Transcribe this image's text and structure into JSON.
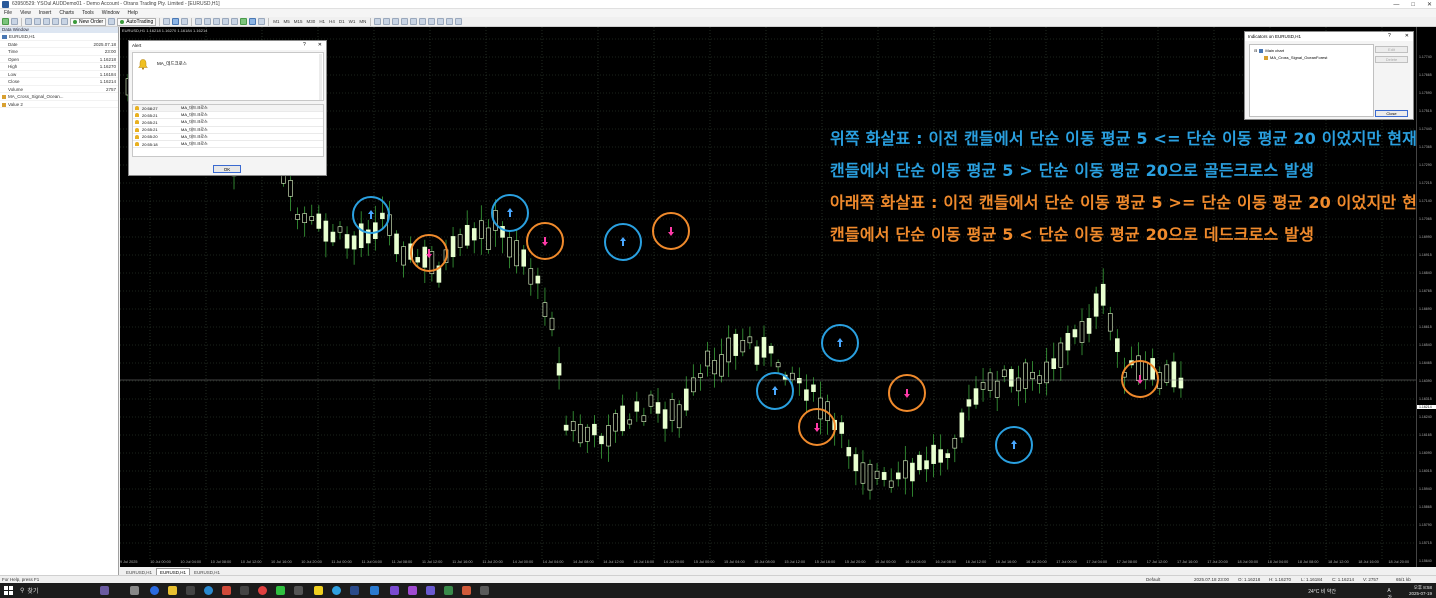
{
  "window": {
    "title": "63950529: YSOul AUDDemo01 - Demo Account - Otrans Trading Pty. Limited - [EURUSD,H1]",
    "controls": [
      "—",
      "□",
      "✕"
    ]
  },
  "menu": [
    "File",
    "View",
    "Insert",
    "Charts",
    "Tools",
    "Window",
    "Help"
  ],
  "toolbar": {
    "new_order_label": "New Order",
    "autotrading_label": "AutoTrading",
    "timeframes": [
      "M1",
      "M5",
      "M15",
      "M30",
      "H1",
      "H4",
      "D1",
      "W1",
      "MN"
    ]
  },
  "data_window": {
    "title": "Data Window",
    "symbol": "EURUSD,H1",
    "rows": [
      {
        "key": "Date",
        "value": "2025.07.18"
      },
      {
        "key": "Time",
        "value": "23:00"
      },
      {
        "key": "Open",
        "value": "1.16218"
      },
      {
        "key": "High",
        "value": "1.16270"
      },
      {
        "key": "Low",
        "value": "1.16184"
      },
      {
        "key": "Close",
        "value": "1.16214"
      },
      {
        "key": "Volume",
        "value": "2757"
      }
    ],
    "indicator": "MA_Cross_Signal_Ocean...",
    "value2": "Value 2"
  },
  "chart": {
    "header": "EURUSD,H1  1.16218 1.16270 1.16184 1.16214",
    "colors": {
      "background": "#000000",
      "candle": "#e8ffd0",
      "wick": "#3aa03a",
      "grid": "#3a4a3a",
      "up_arrow": "#4aa8ff",
      "down_arrow": "#ff3aa8",
      "blue_circle": "#2aa0e0",
      "orange_circle": "#f08a2c"
    },
    "annotations": [
      {
        "text": "위쪽 화살표 : 이전 캔들에서 단순 이동 평균 5 <= 단순 이동 평균 20 이었지만 현재",
        "color": "blue"
      },
      {
        "text": "캔들에서 단순 이동 평균 5 > 단순 이동 평균 20으로 골든크로스 발생",
        "color": "blue"
      },
      {
        "text": "아래쪽 화살표 : 이전 캔들에서 단순 이동 평균 5 >= 단순 이동 평균 20 이었지만 현재",
        "color": "orange"
      },
      {
        "text": "캔들에서 단순 이동 평균 5 < 단순 이동 평균 20으로 데드크로스 발생",
        "color": "orange"
      }
    ],
    "signals": [
      {
        "type": "up",
        "index": 23
      },
      {
        "type": "down",
        "index": 29
      },
      {
        "type": "up",
        "index": 36
      },
      {
        "type": "down",
        "index": 39
      },
      {
        "type": "up",
        "index": 46
      },
      {
        "type": "down",
        "index": 51
      },
      {
        "type": "up",
        "index": 59
      },
      {
        "type": "down",
        "index": 64
      },
      {
        "type": "up",
        "index": 67
      },
      {
        "type": "down",
        "index": 73
      },
      {
        "type": "up",
        "index": 83
      },
      {
        "type": "down",
        "index": 93
      }
    ],
    "time_labels": [
      "9 Jul 2025",
      "10 Jul 00:00",
      "10 Jul 04:00",
      "10 Jul 08:00",
      "10 Jul 12:00",
      "10 Jul 16:00",
      "10 Jul 20:00",
      "11 Jul 00:00",
      "11 Jul 04:00",
      "11 Jul 08:00",
      "11 Jul 12:00",
      "11 Jul 16:00",
      "11 Jul 20:00",
      "14 Jul 00:00",
      "14 Jul 04:00",
      "14 Jul 08:00",
      "14 Jul 12:00",
      "14 Jul 16:00",
      "14 Jul 20:00",
      "15 Jul 00:00",
      "15 Jul 04:00",
      "15 Jul 08:00",
      "15 Jul 12:00",
      "15 Jul 16:00",
      "15 Jul 20:00",
      "16 Jul 00:00",
      "16 Jul 04:00",
      "16 Jul 08:00",
      "16 Jul 12:00",
      "16 Jul 16:00",
      "16 Jul 20:00",
      "17 Jul 00:00",
      "17 Jul 04:00",
      "17 Jul 08:00",
      "17 Jul 12:00",
      "17 Jul 16:00",
      "17 Jul 20:00",
      "18 Jul 00:00",
      "18 Jul 04:00",
      "18 Jul 08:00",
      "18 Jul 12:00",
      "18 Jul 16:00",
      "18 Jul 20:00"
    ],
    "price_labels": [
      "1.17740",
      "1.17665",
      "1.17590",
      "1.17515",
      "1.17440",
      "1.17365",
      "1.17290",
      "1.17215",
      "1.17140",
      "1.17065",
      "1.16990",
      "1.16915",
      "1.16840",
      "1.16765",
      "1.16690",
      "1.16615",
      "1.16540",
      "1.16465",
      "1.16390",
      "1.16315",
      "1.16240",
      "1.16165",
      "1.16090",
      "1.16015",
      "1.15940",
      "1.15865",
      "1.15790",
      "1.15715",
      "1.15640",
      "1.15565"
    ],
    "current_price": "1.16214"
  },
  "tabs": [
    "EURUSD,H1",
    "EURUSD,H1",
    "EURUSD,H1"
  ],
  "active_tab": 1,
  "status": {
    "help": "For Help, press F1",
    "profile": "Default",
    "datetime": "2025.07.18 23:00",
    "open": "O: 1.16218",
    "high": "H: 1.16270",
    "low": "L: 1.16184",
    "close": "C: 1.16214",
    "volume": "V: 2757",
    "traffic": "65/1 kb"
  },
  "alert": {
    "title": "Alert",
    "message": "MA_데드크로스",
    "rows": [
      {
        "time": "20:58:27",
        "msg": "MA_데드크로스"
      },
      {
        "time": "20:55:21",
        "msg": "MA_데드크로스"
      },
      {
        "time": "20:55:21",
        "msg": "MA_데드크로스"
      },
      {
        "time": "20:55:21",
        "msg": "MA_데드크로스"
      },
      {
        "time": "20:55:20",
        "msg": "MA_데드크로스"
      },
      {
        "time": "20:55:18",
        "msg": "MA_데드크로스"
      }
    ],
    "ok_label": "OK"
  },
  "indicators": {
    "title": "Indicators on EURUSD,H1",
    "tree_root": "Main chart",
    "tree_item": "MA_Cross_Signal_OceanForest",
    "edit_label": "Edit",
    "delete_label": "Delete",
    "close_label": "Close"
  },
  "taskbar": {
    "search_label": "찾기",
    "weather": "24°C  비 약간",
    "ime": "A  가",
    "time": "오후 8:58",
    "date": "2025-07-19"
  }
}
